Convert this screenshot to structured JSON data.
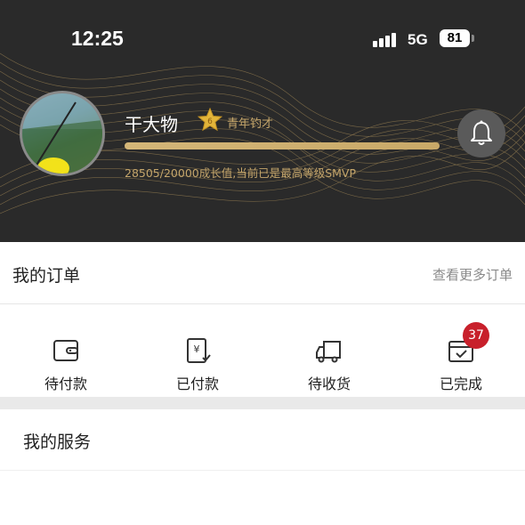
{
  "status_bar": {
    "time": "12:25",
    "network": "5G",
    "battery": "81",
    "signal_icon": "cellular-signal-icon"
  },
  "profile": {
    "name": "干大物",
    "level_badge": "6",
    "level_title": "青年钓才",
    "growth_progress": 1.0,
    "growth_text": "28505/20000成长值,当前已是最高等级SMVP",
    "bell_icon": "bell-icon",
    "accent_color": "#c5a66b"
  },
  "orders": {
    "title": "我的订单",
    "view_more": "查看更多订单",
    "items": [
      {
        "label": "待付款",
        "icon": "wallet-icon"
      },
      {
        "label": "已付款",
        "icon": "paid-receipt-icon"
      },
      {
        "label": "待收货",
        "icon": "delivery-truck-icon"
      },
      {
        "label": "已完成",
        "icon": "completed-box-icon",
        "badge": "37"
      }
    ],
    "badge_color": "#c8202b"
  },
  "services": {
    "title": "我的服务"
  }
}
